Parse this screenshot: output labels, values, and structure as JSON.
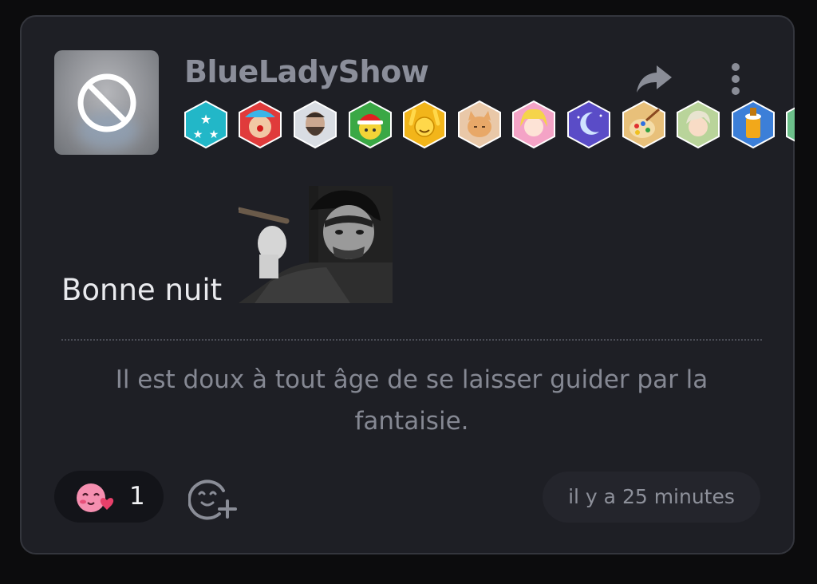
{
  "post": {
    "username": "BlueLadyShow",
    "message": "Bonne nuit",
    "quote": "Il est doux à tout âge de se laisser guider par la fantaisie.",
    "timestamp": "il y a 25 minutes"
  },
  "avatar": {
    "icon": "blocked-icon"
  },
  "actions": {
    "share_icon": "share-icon",
    "more_icon": "more-vertical-icon"
  },
  "badges": [
    {
      "name": "stars-badge",
      "color": "#22b7c8"
    },
    {
      "name": "clown-badge",
      "color": "#e03b3b"
    },
    {
      "name": "bearded-man-badge",
      "color": "#d9dde3"
    },
    {
      "name": "santa-smiley-badge",
      "color": "#3aa845"
    },
    {
      "name": "hands-up-smiley-badge",
      "color": "#f2b51a"
    },
    {
      "name": "cat-badge",
      "color": "#e9c8a8"
    },
    {
      "name": "anime-girl-badge",
      "color": "#f4a3c6"
    },
    {
      "name": "moon-night-badge",
      "color": "#5a4cc7"
    },
    {
      "name": "palette-badge",
      "color": "#e8c07a"
    },
    {
      "name": "anime-boy-badge",
      "color": "#b9d49a"
    },
    {
      "name": "beer-badge",
      "color": "#3c7fd8"
    },
    {
      "name": "partial-badge",
      "color": "#6cc08a"
    }
  ],
  "reaction": {
    "icon": "blushing-heart-icon",
    "count": "1"
  },
  "add_reaction": {
    "icon": "add-reaction-icon"
  }
}
